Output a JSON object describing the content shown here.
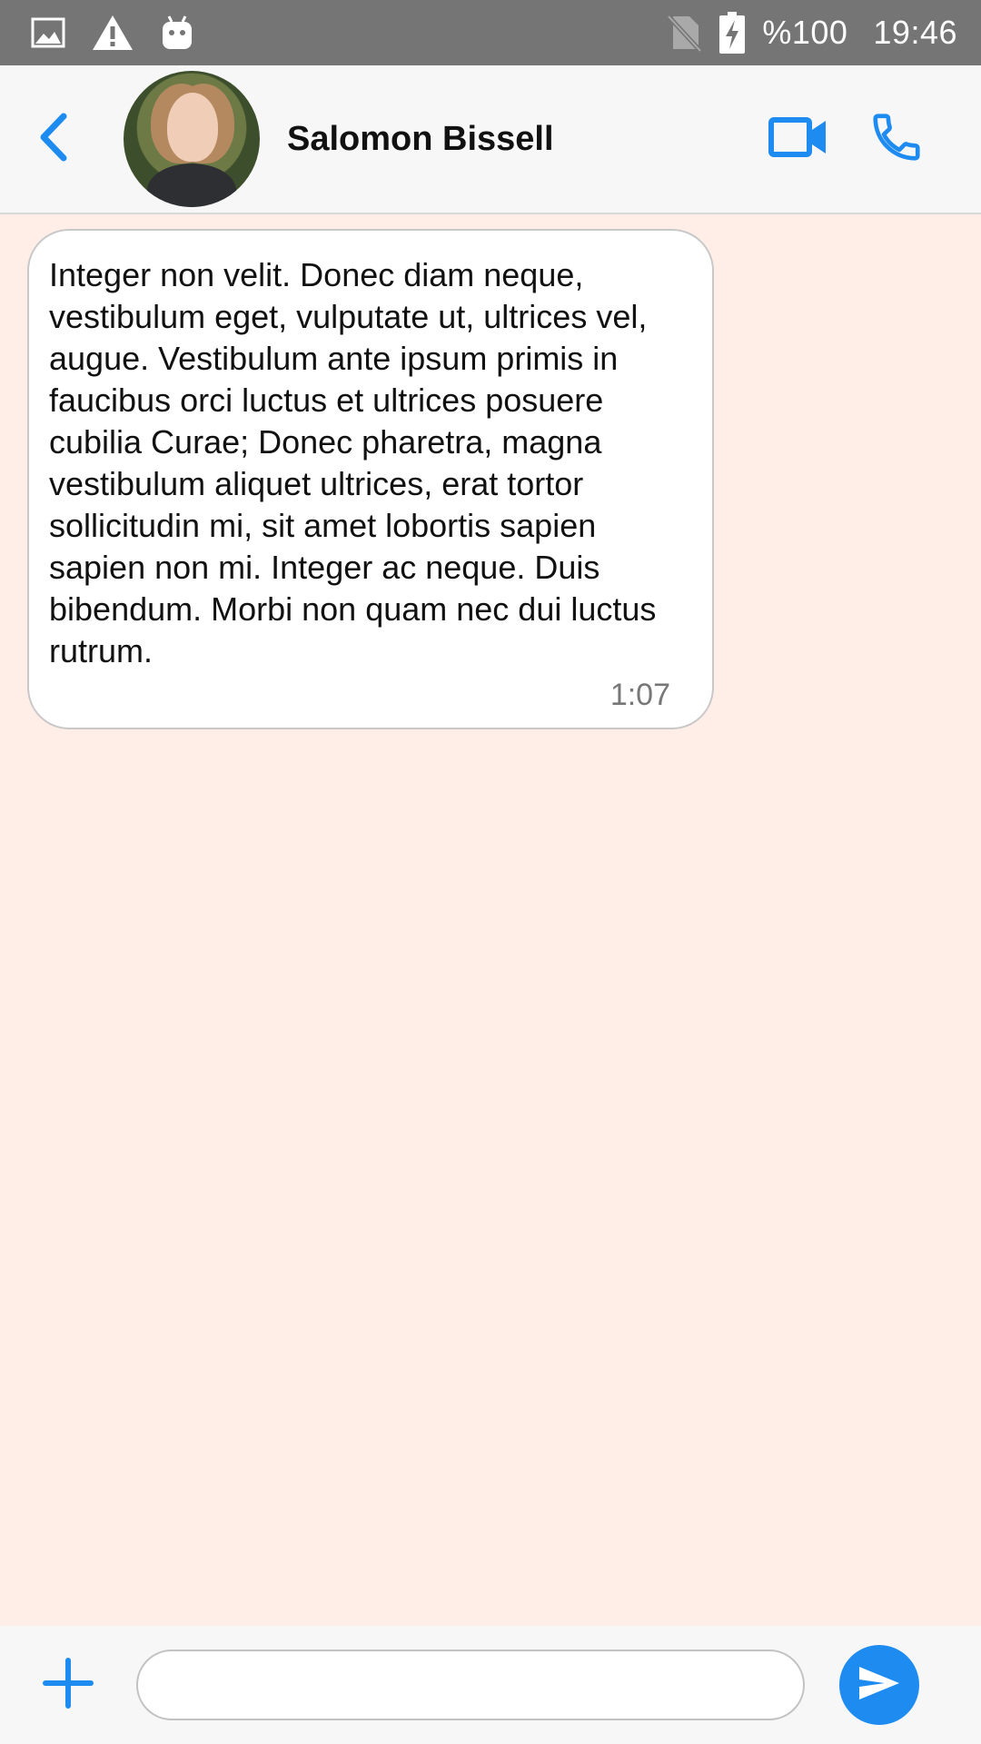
{
  "status_bar": {
    "battery_text": "%100",
    "time": "19:46",
    "icons": [
      "image-icon",
      "warning-icon",
      "android-icon",
      "no-sim-icon",
      "battery-charging-icon"
    ]
  },
  "header": {
    "contact_name": "Salomon Bissell",
    "back_icon": "chevron-left-icon",
    "video_icon": "video-camera-icon",
    "call_icon": "phone-icon",
    "accent_color": "#1e8bf0"
  },
  "messages": [
    {
      "text": "Integer non velit. Donec diam neque, vestibulum eget, vulputate ut, ultrices vel, augue. Vestibulum ante ipsum primis in faucibus orci luctus et ultrices posuere cubilia Curae; Donec pharetra, magna vestibulum aliquet ultrices, erat tortor sollicitudin mi, sit amet lobortis sapien sapien non mi. Integer ac neque. Duis bibendum. Morbi non quam nec dui luctus rutrum.",
      "time": "1:07"
    }
  ],
  "composer": {
    "input_value": "",
    "add_icon": "plus-icon",
    "send_icon": "send-icon"
  },
  "colors": {
    "chat_background": "#ffeee7",
    "status_bar": "#757575",
    "accent": "#1e8bf0"
  }
}
